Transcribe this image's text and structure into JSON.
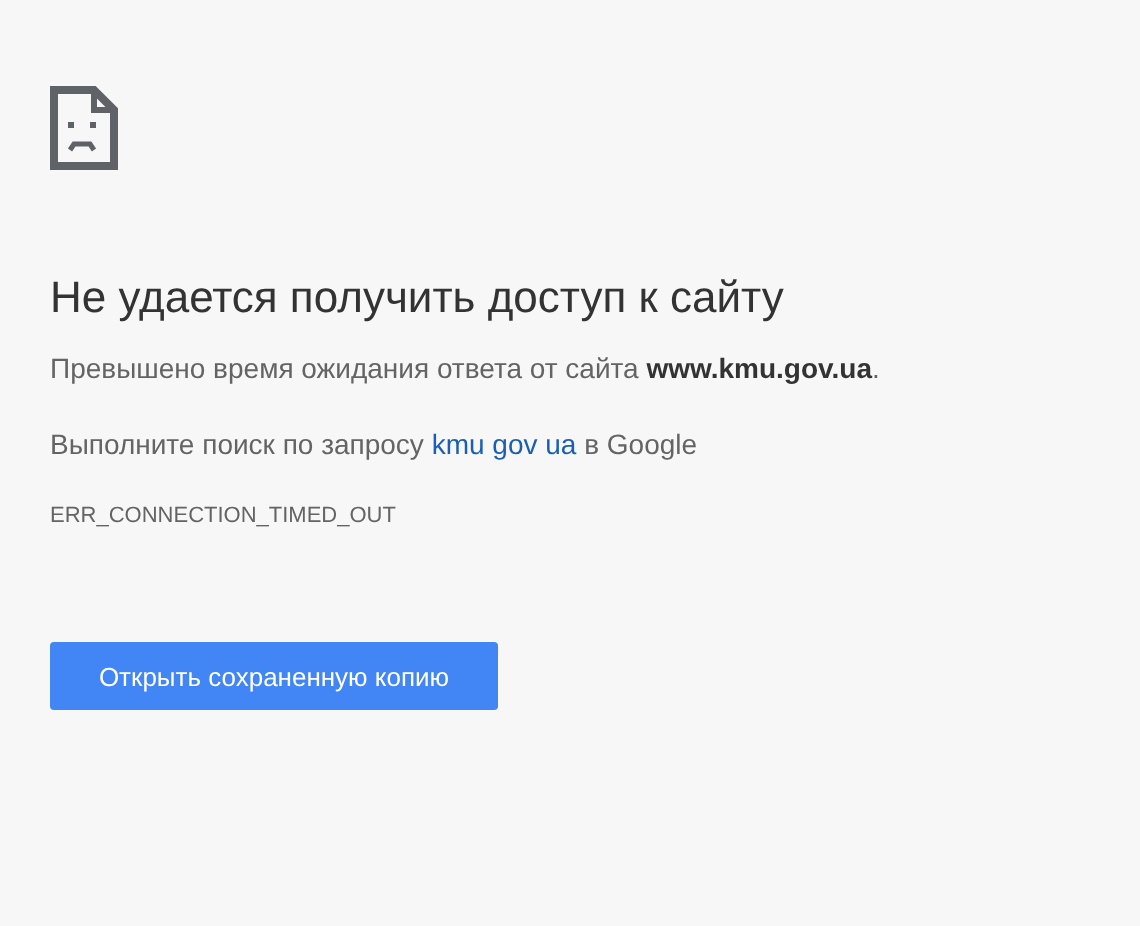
{
  "heading": "Не удается получить доступ к сайту",
  "message": "Превышено время ожидания ответа от сайта **www.kmu.gov.ua**.",
  "search": {
    "before": "Выполните поиск по запросу ",
    "link": "kmu gov ua",
    "after": " в Google"
  },
  "error_code": "ERR_CONNECTION_TIMED_OUT",
  "button": "Открыть сохраненную копию"
}
